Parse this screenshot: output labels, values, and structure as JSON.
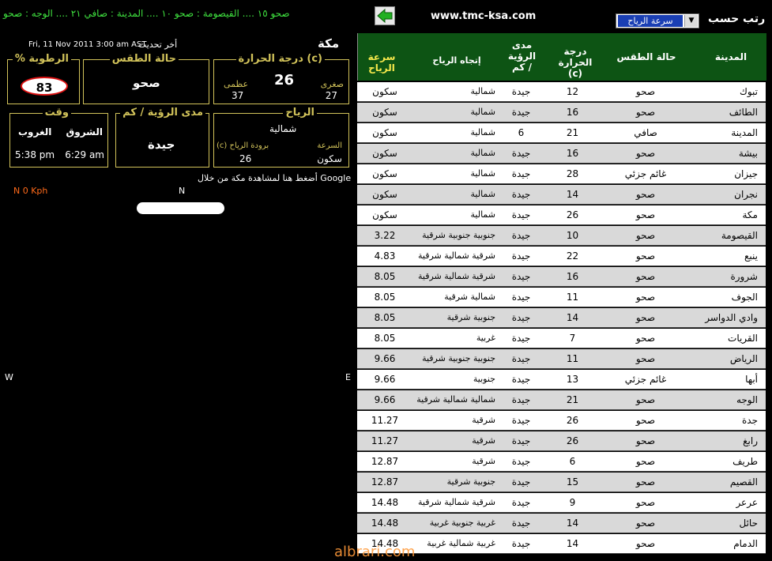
{
  "topbar": {
    "ticker": "صحو ١٥  ....  القيصومة : صحو ١٠  ....  المدينة : صافي ٢١  ....  الوجه : صحو",
    "site_url": "www.tmc-ksa.com",
    "sort_label": "رتب حسب",
    "sort_value": "سرعة الرياح"
  },
  "city": {
    "name": "مكة",
    "last_update_label": "أخر تحديث",
    "last_update_date": "Fri, 11 Nov 2011 3:00 am AST",
    "temperature": {
      "title": "درجة الحرارة (c)",
      "current": "26",
      "min_label": "صغرى",
      "min": "27",
      "max_label": "عظمى",
      "max": "37"
    },
    "condition": {
      "title": "حالة الطقس",
      "value": "صحو"
    },
    "humidity": {
      "title": "% الرطوبة",
      "value": "83"
    },
    "wind": {
      "title": "الرياح",
      "direction": "شمالية",
      "speed_label": "السرعة",
      "speed": "سكون",
      "chill_label": "(c) برودة  الرياح",
      "chill": "26"
    },
    "visibility": {
      "title": "مدى الرؤية / كم",
      "value": "جيدة"
    },
    "time": {
      "title": "وقت",
      "sunrise_label": "الشروق",
      "sunrise": "6:29 am",
      "sunset_label": "الغروب",
      "sunset": "5:38 pm"
    },
    "google_link": "أضغط هنا لمشاهدة مكة من خلال Google",
    "compass": {
      "speed": "N  0 Kph",
      "n": "N",
      "w": "W",
      "e": "E"
    }
  },
  "table": {
    "headers": {
      "city": "المدينة",
      "condition": "حالة الطقس",
      "temp": "درجة الحرارة (c)",
      "visibility": "مدى الرؤية كم /",
      "direction": "إتجاه الرياح",
      "speed": "سرعة الرياح"
    },
    "rows": [
      {
        "city": "تبوك",
        "cond": "صحو",
        "temp": "12",
        "vis": "جيدة",
        "dir": "شمالية",
        "speed": "سكون"
      },
      {
        "city": "الطائف",
        "cond": "صحو",
        "temp": "16",
        "vis": "جيدة",
        "dir": "شمالية",
        "speed": "سكون"
      },
      {
        "city": "المدينة",
        "cond": "صافي",
        "temp": "21",
        "vis": "6",
        "dir": "شمالية",
        "speed": "سكون"
      },
      {
        "city": "بيشة",
        "cond": "صحو",
        "temp": "16",
        "vis": "جيدة",
        "dir": "شمالية",
        "speed": "سكون"
      },
      {
        "city": "جيزان",
        "cond": "غائم جزئي",
        "temp": "28",
        "vis": "جيدة",
        "dir": "شمالية",
        "speed": "سكون"
      },
      {
        "city": "نجران",
        "cond": "صحو",
        "temp": "14",
        "vis": "جيدة",
        "dir": "شمالية",
        "speed": "سكون"
      },
      {
        "city": "مكة",
        "cond": "صحو",
        "temp": "26",
        "vis": "جيدة",
        "dir": "شمالية",
        "speed": "سكون"
      },
      {
        "city": "القيصومة",
        "cond": "صحو",
        "temp": "10",
        "vis": "جيدة",
        "dir": "جنوبية جنوبية شرقية",
        "speed": "3.22"
      },
      {
        "city": "ينبع",
        "cond": "صحو",
        "temp": "22",
        "vis": "جيدة",
        "dir": "شرقية شمالية شرقية",
        "speed": "4.83"
      },
      {
        "city": "شرورة",
        "cond": "صحو",
        "temp": "16",
        "vis": "جيدة",
        "dir": "شرقية شمالية شرقية",
        "speed": "8.05"
      },
      {
        "city": "الجوف",
        "cond": "صحو",
        "temp": "11",
        "vis": "جيدة",
        "dir": "شمالية شرقية",
        "speed": "8.05"
      },
      {
        "city": "وادي الدواسر",
        "cond": "صحو",
        "temp": "14",
        "vis": "جيدة",
        "dir": "جنوبية شرقية",
        "speed": "8.05"
      },
      {
        "city": "القريات",
        "cond": "صحو",
        "temp": "7",
        "vis": "جيدة",
        "dir": "غربية",
        "speed": "8.05"
      },
      {
        "city": "الرياض",
        "cond": "صحو",
        "temp": "11",
        "vis": "جيدة",
        "dir": "جنوبية جنوبية شرقية",
        "speed": "9.66"
      },
      {
        "city": "أبها",
        "cond": "غائم جزئي",
        "temp": "13",
        "vis": "جيدة",
        "dir": "جنوبية",
        "speed": "9.66"
      },
      {
        "city": "الوجه",
        "cond": "صحو",
        "temp": "21",
        "vis": "جيدة",
        "dir": "شمالية شمالية شرقية",
        "speed": "9.66"
      },
      {
        "city": "جدة",
        "cond": "صحو",
        "temp": "26",
        "vis": "جيدة",
        "dir": "شرقية",
        "speed": "11.27"
      },
      {
        "city": "رابغ",
        "cond": "صحو",
        "temp": "26",
        "vis": "جيدة",
        "dir": "شرقية",
        "speed": "11.27"
      },
      {
        "city": "طريف",
        "cond": "صحو",
        "temp": "6",
        "vis": "جيدة",
        "dir": "شرقية",
        "speed": "12.87"
      },
      {
        "city": "القصيم",
        "cond": "صحو",
        "temp": "15",
        "vis": "جيدة",
        "dir": "جنوبية شرقية",
        "speed": "12.87"
      },
      {
        "city": "عرعر",
        "cond": "صحو",
        "temp": "9",
        "vis": "جيدة",
        "dir": "شرقية شمالية شرقية",
        "speed": "14.48"
      },
      {
        "city": "حائل",
        "cond": "صحو",
        "temp": "14",
        "vis": "جيدة",
        "dir": "غربية جنوبية غربية",
        "speed": "14.48"
      },
      {
        "city": "الدمام",
        "cond": "صحو",
        "temp": "14",
        "vis": "جيدة",
        "dir": "غربية شمالية غربية",
        "speed": "14.48"
      }
    ]
  },
  "watermark": "albrari.com"
}
